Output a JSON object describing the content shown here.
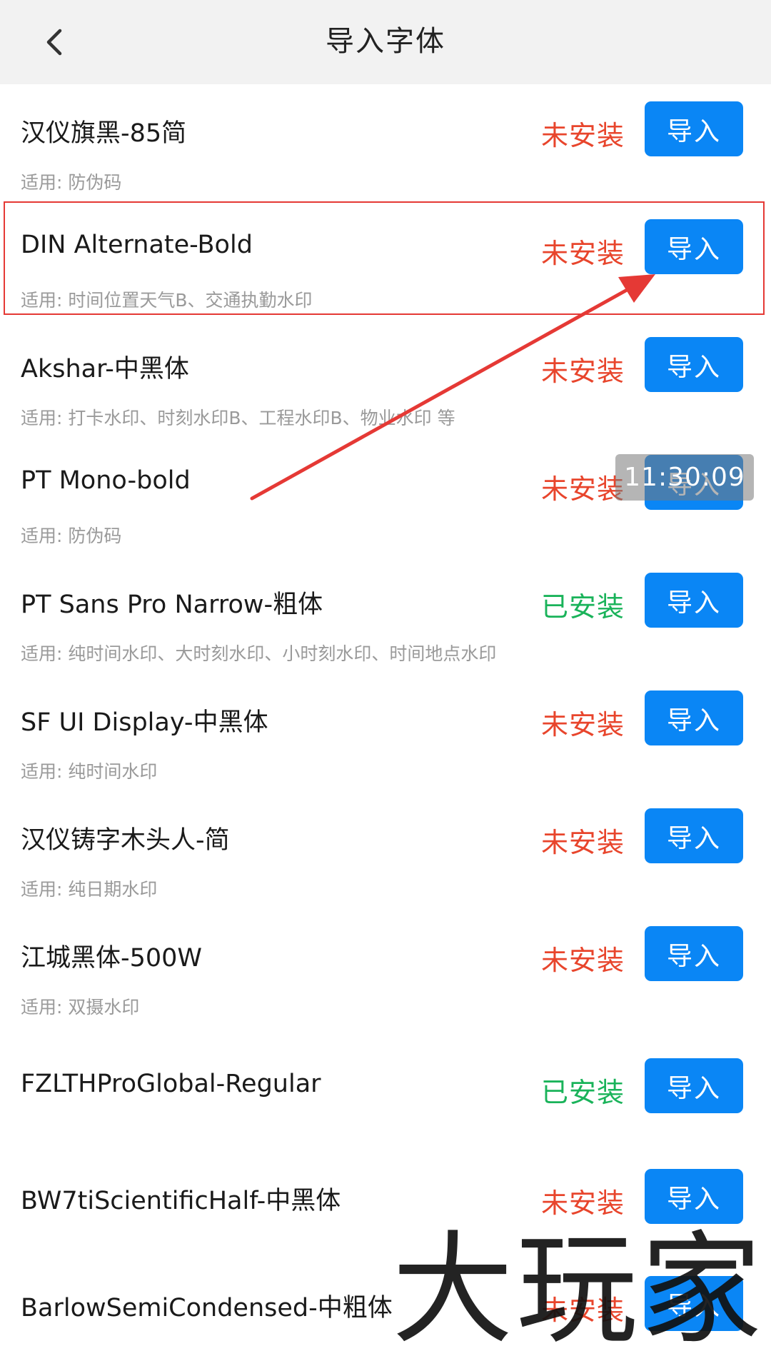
{
  "header": {
    "title": "导入字体",
    "back_icon": "chevron-left-icon"
  },
  "fonts": [
    {
      "name": "汉仪旗黑-85简",
      "usage": "适用: 防伪码",
      "status": "未安装",
      "installed": false,
      "button": "导入"
    },
    {
      "name": "DIN Alternate-Bold",
      "usage": "适用: 时间位置天气B、交通执勤水印",
      "status": "未安装",
      "installed": false,
      "button": "导入"
    },
    {
      "name": "Akshar-中黑体",
      "usage": "适用: 打卡水印、时刻水印B、工程水印B、物业水印 等",
      "status": "未安装",
      "installed": false,
      "button": "导入"
    },
    {
      "name": "PT Mono-bold",
      "usage": "适用: 防伪码",
      "status": "未安装",
      "installed": false,
      "button": "导入"
    },
    {
      "name": "PT Sans Pro Narrow-粗体",
      "usage": "适用: 纯时间水印、大时刻水印、小时刻水印、时间地点水印",
      "status": "已安装",
      "installed": true,
      "button": "导入"
    },
    {
      "name": "SF UI Display-中黑体",
      "usage": "适用: 纯时间水印",
      "status": "未安装",
      "installed": false,
      "button": "导入"
    },
    {
      "name": "汉仪铸字木头人-简",
      "usage": "适用: 纯日期水印",
      "status": "未安装",
      "installed": false,
      "button": "导入"
    },
    {
      "name": "江城黑体-500W",
      "usage": "适用: 双摄水印",
      "status": "未安装",
      "installed": false,
      "button": "导入"
    },
    {
      "name": "FZLTHProGlobal-Regular",
      "usage": "",
      "status": "已安装",
      "installed": true,
      "button": "导入"
    },
    {
      "name": "BW7tiScientificHalf-中黑体",
      "usage": "",
      "status": "未安装",
      "installed": false,
      "button": "导入"
    },
    {
      "name": "BarlowSemiCondensed-中粗体",
      "usage": "",
      "status": "未安装",
      "installed": false,
      "button": "导入"
    }
  ],
  "overlay": {
    "timestamp": "11:30:09",
    "watermark": "大玩家",
    "highlight_color": "#e53935",
    "arrow_color": "#e53935"
  },
  "colors": {
    "accent": "#0a86f5",
    "not_installed": "#e8452c",
    "installed": "#1ab35a"
  }
}
